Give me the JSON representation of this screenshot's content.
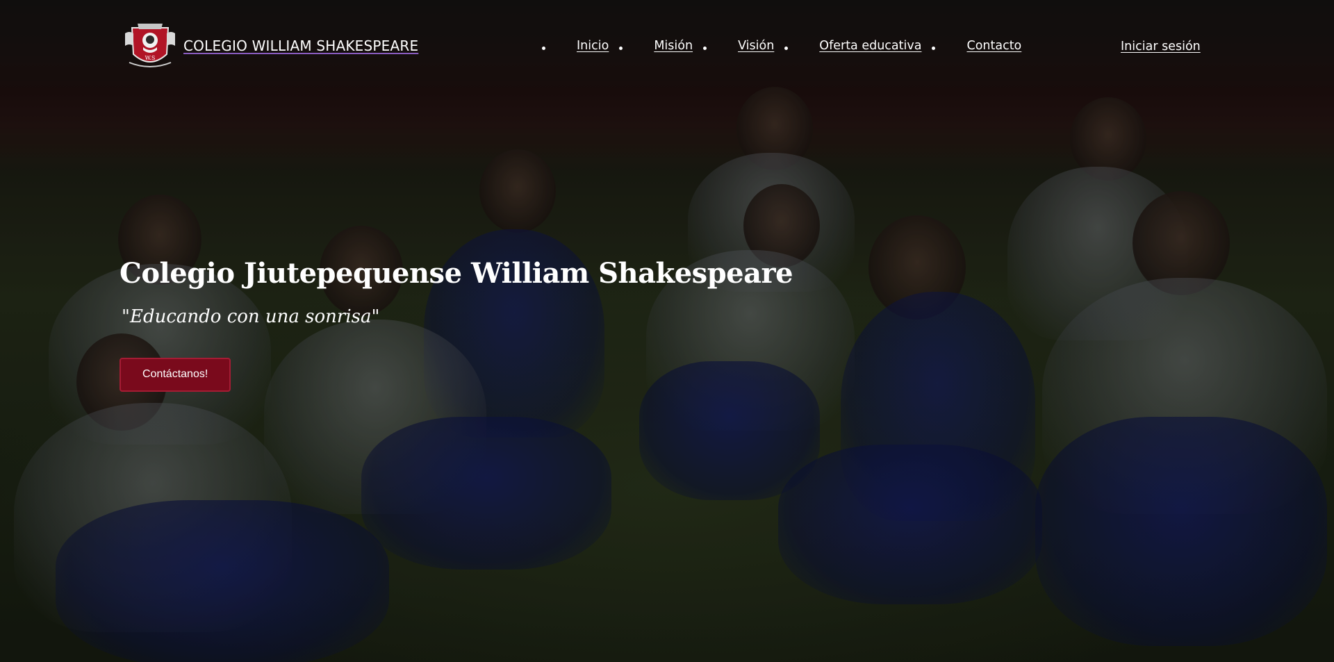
{
  "header": {
    "brand_name": "COLEGIO WILLIAM SHAKESPEARE",
    "logo_icon": "school-crest-icon",
    "nav": [
      {
        "label": "Inicio"
      },
      {
        "label": "Misión"
      },
      {
        "label": "Visión"
      },
      {
        "label": "Oferta educativa"
      },
      {
        "label": "Contacto"
      }
    ],
    "login_label": "Iniciar sesión"
  },
  "hero": {
    "title": "Colegio Jiutepequense William Shakespeare",
    "slogan": "\"Educando con una sonrisa\"",
    "cta_label": "Contáctanos!"
  },
  "colors": {
    "accent": "#7a0a1c",
    "accent_border": "#a51c34",
    "text": "#ffffff",
    "brand_underline": "#8a5cc0"
  }
}
